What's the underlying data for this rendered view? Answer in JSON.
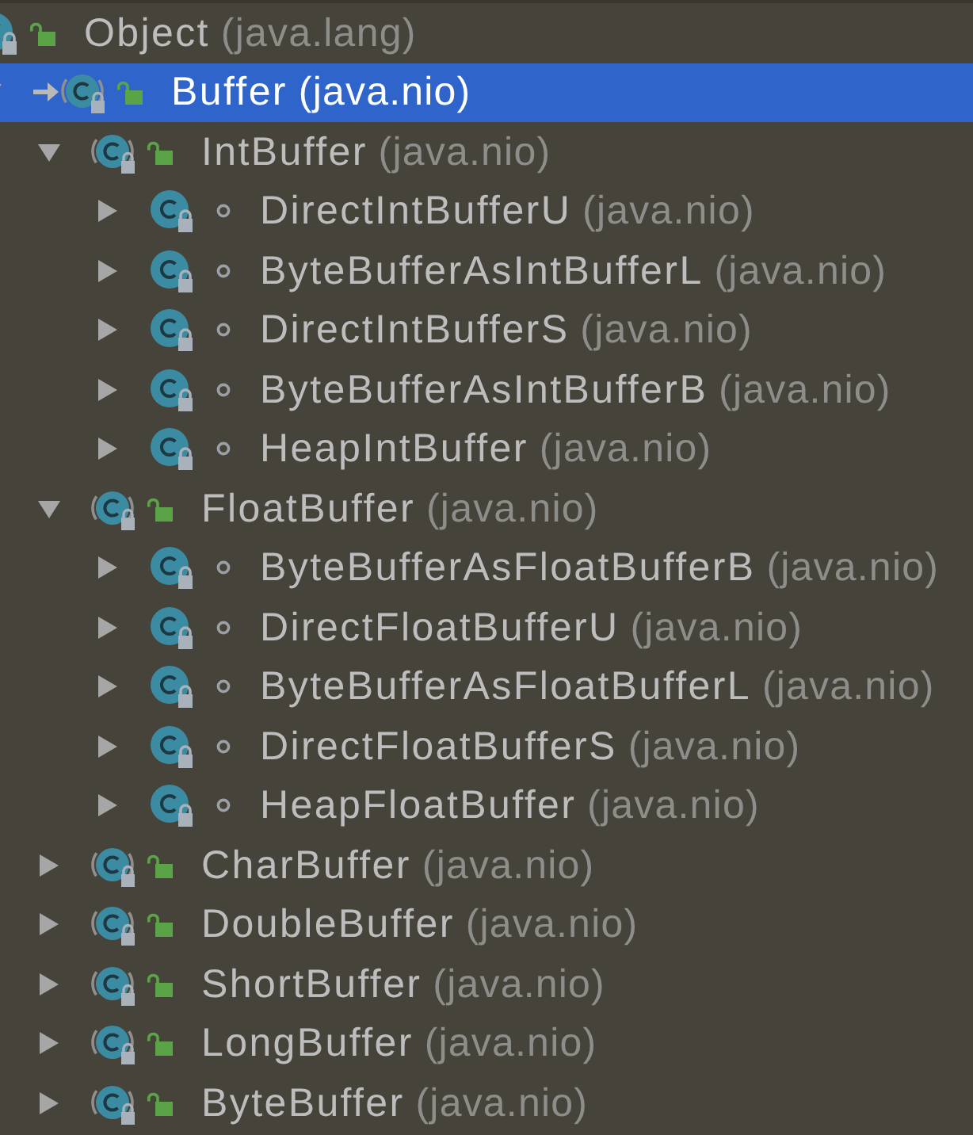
{
  "hierarchy": [
    {
      "name": "Object",
      "package": "(java.lang)",
      "kind": "class",
      "public": true,
      "selected": false,
      "base": false,
      "children": [
        {
          "name": "Buffer",
          "package": "(java.nio)",
          "kind": "abstract",
          "public": true,
          "expanded": true,
          "selected": true,
          "base": true,
          "children": [
            {
              "name": "IntBuffer",
              "package": "(java.nio)",
              "kind": "abstract",
              "public": true,
              "expanded": true,
              "selected": false,
              "base": false,
              "children": [
                {
                  "name": "DirectIntBufferU",
                  "package": "(java.nio)",
                  "kind": "class",
                  "public": false,
                  "expanded": false,
                  "selected": false,
                  "base": false
                },
                {
                  "name": "ByteBufferAsIntBufferL",
                  "package": "(java.nio)",
                  "kind": "class",
                  "public": false,
                  "expanded": false,
                  "selected": false,
                  "base": false
                },
                {
                  "name": "DirectIntBufferS",
                  "package": "(java.nio)",
                  "kind": "class",
                  "public": false,
                  "expanded": false,
                  "selected": false,
                  "base": false
                },
                {
                  "name": "ByteBufferAsIntBufferB",
                  "package": "(java.nio)",
                  "kind": "class",
                  "public": false,
                  "expanded": false,
                  "selected": false,
                  "base": false
                },
                {
                  "name": "HeapIntBuffer",
                  "package": "(java.nio)",
                  "kind": "class",
                  "public": false,
                  "expanded": false,
                  "selected": false,
                  "base": false
                }
              ]
            },
            {
              "name": "FloatBuffer",
              "package": "(java.nio)",
              "kind": "abstract",
              "public": true,
              "expanded": true,
              "selected": false,
              "base": false,
              "children": [
                {
                  "name": "ByteBufferAsFloatBufferB",
                  "package": "(java.nio)",
                  "kind": "class",
                  "public": false,
                  "expanded": false,
                  "selected": false,
                  "base": false
                },
                {
                  "name": "DirectFloatBufferU",
                  "package": "(java.nio)",
                  "kind": "class",
                  "public": false,
                  "expanded": false,
                  "selected": false,
                  "base": false
                },
                {
                  "name": "ByteBufferAsFloatBufferL",
                  "package": "(java.nio)",
                  "kind": "class",
                  "public": false,
                  "expanded": false,
                  "selected": false,
                  "base": false
                },
                {
                  "name": "DirectFloatBufferS",
                  "package": "(java.nio)",
                  "kind": "class",
                  "public": false,
                  "expanded": false,
                  "selected": false,
                  "base": false
                },
                {
                  "name": "HeapFloatBuffer",
                  "package": "(java.nio)",
                  "kind": "class",
                  "public": false,
                  "expanded": false,
                  "selected": false,
                  "base": false
                }
              ]
            },
            {
              "name": "CharBuffer",
              "package": "(java.nio)",
              "kind": "abstract",
              "public": true,
              "expanded": false,
              "selected": false,
              "base": false
            },
            {
              "name": "DoubleBuffer",
              "package": "(java.nio)",
              "kind": "abstract",
              "public": true,
              "expanded": false,
              "selected": false,
              "base": false
            },
            {
              "name": "ShortBuffer",
              "package": "(java.nio)",
              "kind": "abstract",
              "public": true,
              "expanded": false,
              "selected": false,
              "base": false
            },
            {
              "name": "LongBuffer",
              "package": "(java.nio)",
              "kind": "abstract",
              "public": true,
              "expanded": false,
              "selected": false,
              "base": false
            },
            {
              "name": "ByteBuffer",
              "package": "(java.nio)",
              "kind": "abstract",
              "public": true,
              "expanded": false,
              "selected": false,
              "base": false
            }
          ]
        }
      ]
    }
  ]
}
